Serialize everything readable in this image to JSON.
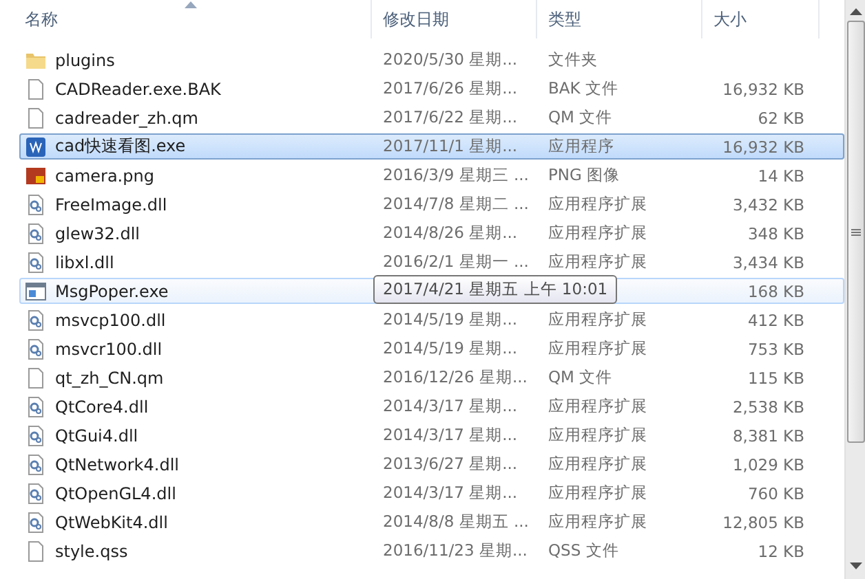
{
  "columns": [
    {
      "label": "名称",
      "sorted": true
    },
    {
      "label": "修改日期",
      "sorted": false
    },
    {
      "label": "类型",
      "sorted": false
    },
    {
      "label": "大小",
      "sorted": false
    }
  ],
  "rows": [
    {
      "kind": "folder",
      "name": "plugins",
      "date": "2020/5/30 星期...",
      "type": "文件夹",
      "selected": false,
      "hovered": false
    },
    {
      "kind": "file",
      "name": "CADReader.exe.BAK",
      "date": "2017/6/26 星期...",
      "type": "BAK 文件",
      "size": "16,932 KB",
      "selected": false,
      "hovered": false
    },
    {
      "kind": "file",
      "name": "cadreader_zh.qm",
      "date": "2017/6/22 星期...",
      "type": "QM 文件",
      "size": "62 KB",
      "selected": false,
      "hovered": false
    },
    {
      "kind": "app",
      "name": "cad快速看图.exe",
      "date": "2017/11/1 星期...",
      "type": "应用程序",
      "size": "16,932 KB",
      "selected": true,
      "hovered": false
    },
    {
      "kind": "image",
      "name": "camera.png",
      "date": "2016/3/9 星期三 ...",
      "type": "PNG 图像",
      "size": "14 KB",
      "selected": false,
      "hovered": false
    },
    {
      "kind": "dll",
      "name": "FreeImage.dll",
      "date": "2014/7/8 星期二 ...",
      "type": "应用程序扩展",
      "size": "3,432 KB",
      "selected": false,
      "hovered": false
    },
    {
      "kind": "dll",
      "name": "glew32.dll",
      "date": "2014/8/26 星期...",
      "type": "应用程序扩展",
      "size": "348 KB",
      "selected": false,
      "hovered": false
    },
    {
      "kind": "dll",
      "name": "libxl.dll",
      "date": "2016/2/1 星期一 ...",
      "type": "应用程序扩展",
      "size": "3,434 KB",
      "selected": false,
      "hovered": false
    },
    {
      "kind": "window",
      "name": "MsgPoper.exe",
      "tooltip": "2017/4/21 星期五 上午 10:01",
      "size": "168 KB",
      "selected": false,
      "hovered": true
    },
    {
      "kind": "dll",
      "name": "msvcp100.dll",
      "date": "2014/5/19 星期...",
      "type": "应用程序扩展",
      "size": "412 KB",
      "selected": false,
      "hovered": false
    },
    {
      "kind": "dll",
      "name": "msvcr100.dll",
      "date": "2014/5/19 星期...",
      "type": "应用程序扩展",
      "size": "753 KB",
      "selected": false,
      "hovered": false
    },
    {
      "kind": "file",
      "name": "qt_zh_CN.qm",
      "date": "2016/12/26 星期...",
      "type": "QM 文件",
      "size": "115 KB",
      "selected": false,
      "hovered": false
    },
    {
      "kind": "dll",
      "name": "QtCore4.dll",
      "date": "2014/3/17 星期...",
      "type": "应用程序扩展",
      "size": "2,538 KB",
      "selected": false,
      "hovered": false
    },
    {
      "kind": "dll",
      "name": "QtGui4.dll",
      "date": "2014/3/17 星期...",
      "type": "应用程序扩展",
      "size": "8,381 KB",
      "selected": false,
      "hovered": false
    },
    {
      "kind": "dll",
      "name": "QtNetwork4.dll",
      "date": "2013/6/27 星期...",
      "type": "应用程序扩展",
      "size": "1,029 KB",
      "selected": false,
      "hovered": false
    },
    {
      "kind": "dll",
      "name": "QtOpenGL4.dll",
      "date": "2014/3/17 星期...",
      "type": "应用程序扩展",
      "size": "760 KB",
      "selected": false,
      "hovered": false
    },
    {
      "kind": "dll",
      "name": "QtWebKit4.dll",
      "date": "2014/8/8 星期五 ...",
      "type": "应用程序扩展",
      "size": "12,805 KB",
      "selected": false,
      "hovered": false
    },
    {
      "kind": "file",
      "name": "style.qss",
      "date": "2016/11/23 星期...",
      "type": "QSS 文件",
      "size": "12 KB",
      "selected": false,
      "hovered": false
    }
  ]
}
